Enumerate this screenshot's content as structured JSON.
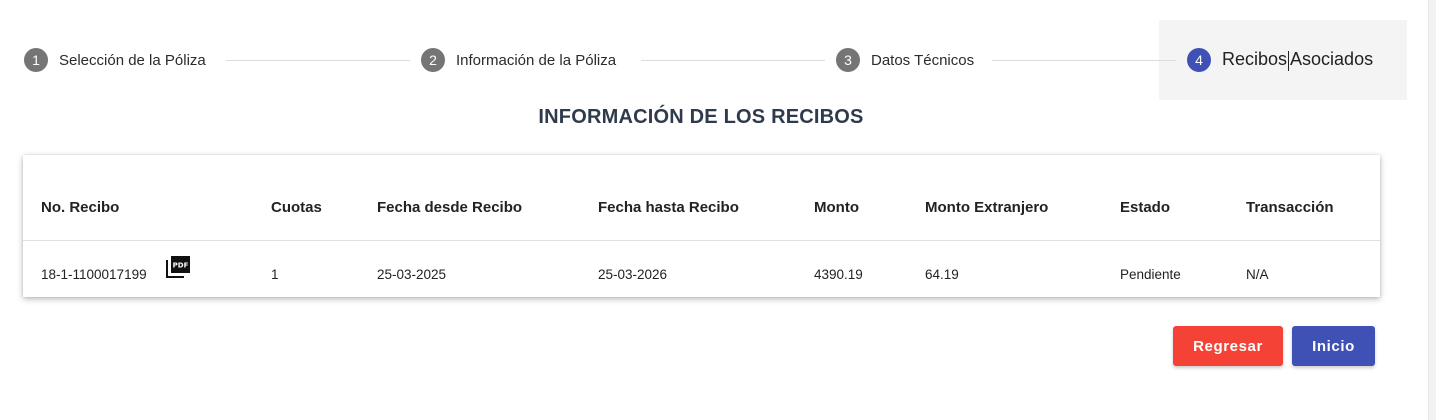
{
  "stepper": {
    "steps": [
      {
        "number": "1",
        "label": "Selección de la Póliza"
      },
      {
        "number": "2",
        "label": "Información de la Póliza"
      },
      {
        "number": "3",
        "label": "Datos Técnicos"
      },
      {
        "number": "4",
        "label_a": "Recibos",
        "label_b": "Asociados"
      }
    ],
    "active_step": 4
  },
  "section": {
    "title": "INFORMACIÓN DE LOS RECIBOS"
  },
  "table": {
    "headers": [
      "No. Recibo",
      "Cuotas",
      "Fecha desde Recibo",
      "Fecha hasta Recibo",
      "Monto",
      "Monto Extranjero",
      "Estado",
      "Transacción"
    ],
    "rows": [
      {
        "recibo": "18-1-1100017199",
        "cuotas": "1",
        "fecha_desde": "25-03-2025",
        "fecha_hasta": "25-03-2026",
        "monto": "4390.19",
        "monto_extranjero": "64.19",
        "estado": "Pendiente",
        "transaccion": "N/A",
        "icon": "pdf-icon"
      }
    ]
  },
  "buttons": {
    "back_label": "Regresar",
    "home_label": "Inicio"
  },
  "colors": {
    "primary": "#3f51b5",
    "danger": "#f44336",
    "step_inactive": "#757575"
  }
}
